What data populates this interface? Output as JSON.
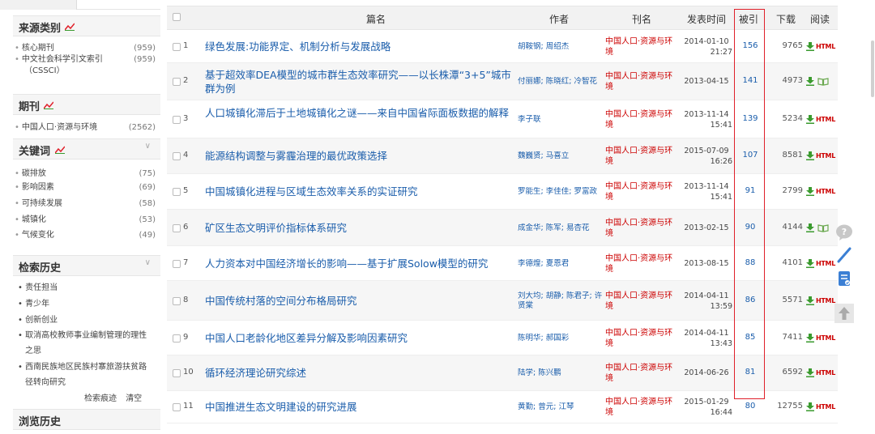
{
  "sidebar": {
    "source": {
      "title": "来源类别",
      "items": [
        {
          "label": "核心期刊",
          "count": "(959)"
        },
        {
          "label": "中文社会科学引文索引",
          "count": "(959)"
        },
        {
          "label": "（CSSCI）",
          "count": ""
        }
      ]
    },
    "journal": {
      "title": "期刊",
      "items": [
        {
          "label": "中国人口·资源与环境",
          "count": "(2562)"
        }
      ]
    },
    "keywords": {
      "title": "关键词",
      "items": [
        {
          "label": "碳排放",
          "count": "(75)"
        },
        {
          "label": "影响因素",
          "count": "(69)"
        },
        {
          "label": "可持续发展",
          "count": "(58)"
        },
        {
          "label": "城镇化",
          "count": "(53)"
        },
        {
          "label": "气候变化",
          "count": "(49)"
        }
      ]
    },
    "search_history": {
      "title": "检索历史",
      "items": [
        "责任担当",
        "青少年",
        "创新创业",
        "取消高校教师事业编制管理的理性",
        "之思",
        "西南民族地区民族村寨旅游扶贫路",
        "径转向研究"
      ],
      "trace_label": "检索痕迹",
      "clear_label": "清空"
    },
    "browse_history": {
      "title": "浏览历史"
    }
  },
  "table": {
    "headers": {
      "title": "篇名",
      "author": "作者",
      "journal": "刊名",
      "date": "发表时间",
      "cite": "被引",
      "download": "下载",
      "read": "阅读"
    },
    "rows": [
      {
        "idx": "1",
        "title": "绿色发展:功能界定、机制分析与发展战略",
        "authors": "胡鞍钢; 周绍杰",
        "journal": "中国人口·资源与环境",
        "date": "2014-01-10",
        "time": "21:27",
        "cite": "156",
        "downloads": "9765",
        "read": "HTML"
      },
      {
        "idx": "2",
        "title": "基于超效率DEA模型的城市群生态效率研究——以长株潭“3+5”城市群为例",
        "authors": "付丽娜; 陈晓红; 冷智花",
        "journal": "中国人口·资源与环境",
        "date": "2013-04-15",
        "time": "",
        "cite": "141",
        "downloads": "4973",
        "read": "book"
      },
      {
        "idx": "3",
        "title": "人口城镇化滞后于土地城镇化之谜——来自中国省际面板数据的解释",
        "authors": "李子联",
        "journal": "中国人口·资源与环境",
        "date": "2013-11-14",
        "time": "15:41",
        "cite": "139",
        "downloads": "5234",
        "read": "HTML"
      },
      {
        "idx": "4",
        "title": "能源结构调整与雾霾治理的最优政策选择",
        "authors": "魏巍贤; 马喜立",
        "journal": "中国人口·资源与环境",
        "date": "2015-07-09",
        "time": "16:26",
        "cite": "107",
        "downloads": "8581",
        "read": "HTML"
      },
      {
        "idx": "5",
        "title": "中国城镇化进程与区域生态效率关系的实证研究",
        "authors": "罗能生; 李佳佳; 罗富政",
        "journal": "中国人口·资源与环境",
        "date": "2013-11-14",
        "time": "15:41",
        "cite": "91",
        "downloads": "2799",
        "read": "HTML"
      },
      {
        "idx": "6",
        "title": "矿区生态文明评价指标体系研究",
        "authors": "成金华; 陈军; 易杏花",
        "journal": "中国人口·资源与环境",
        "date": "2013-02-15",
        "time": "",
        "cite": "90",
        "downloads": "4144",
        "read": "book"
      },
      {
        "idx": "7",
        "title": "人力资本对中国经济增长的影响——基于扩展Solow模型的研究",
        "authors": "李德煌; 夏恩君",
        "journal": "中国人口·资源与环境",
        "date": "2013-08-15",
        "time": "",
        "cite": "88",
        "downloads": "4101",
        "read": "HTML"
      },
      {
        "idx": "8",
        "title": "中国传统村落的空间分布格局研究",
        "authors": "刘大均; 胡静; 陈君子; 许贤棠",
        "journal": "中国人口·资源与环境",
        "date": "2014-04-11",
        "time": "13:59",
        "cite": "86",
        "downloads": "5571",
        "read": "HTML"
      },
      {
        "idx": "9",
        "title": "中国人口老龄化地区差异分解及影响因素研究",
        "authors": "陈明华; 郝国彩",
        "journal": "中国人口·资源与环境",
        "date": "2014-04-11",
        "time": "13:43",
        "cite": "85",
        "downloads": "7411",
        "read": "HTML"
      },
      {
        "idx": "10",
        "title": "循环经济理论研究综述",
        "authors": "陆学; 陈兴鹏",
        "journal": "中国人口·资源与环境",
        "date": "2014-06-26",
        "time": "",
        "cite": "81",
        "downloads": "6592",
        "read": "HTML"
      },
      {
        "idx": "11",
        "title": "中国推进生态文明建设的研究进展",
        "authors": "黄勤; 曾元; 江琴",
        "journal": "中国人口·资源与环境",
        "date": "2015-01-29",
        "time": "16:44",
        "cite": "80",
        "downloads": "12755",
        "read": "HTML"
      }
    ]
  },
  "colors": {
    "link": "#1a5dab",
    "journal": "#cc0000",
    "highlight_box": "#e0202a",
    "download_icon": "#3a9a2e",
    "read_book_icon": "#6aa84f"
  },
  "icons": {
    "section_icon": "trend-chart-icon",
    "collapse": "chevron-down-icon",
    "download": "download-arrow-icon",
    "read_html": "html-badge",
    "read_book": "open-book-icon",
    "tools": [
      "feedback-bubble-icon",
      "pencil-icon",
      "notes-icon",
      "back-to-top-icon"
    ]
  }
}
